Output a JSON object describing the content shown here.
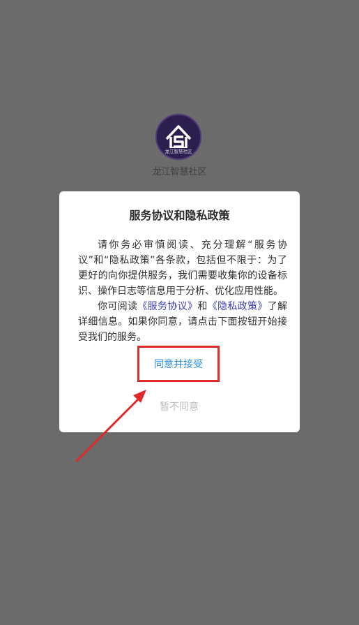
{
  "app": {
    "name": "龙江智慧社区",
    "logo_text": "龙江智慧社区"
  },
  "dialog": {
    "title": "服务协议和隐私政策",
    "paragraph1": "请你务必审慎阅读、充分理解“服务协议”和“隐私政策”各条款，包括但不限于：为了更好的向你提供服务，我们需要收集你的设备标识、操作日志等信息用于分析、优化应用性能。",
    "p2_prefix": "你可阅读",
    "service_link": "《服务协议》",
    "p2_and": "和",
    "privacy_link": "《隐私政策》",
    "p2_suffix": "了解详细信息。如果你同意，请点击下面按钮开始接受我们的服务。",
    "accept_label": "同意并接受",
    "decline_label": "暂不同意"
  },
  "colors": {
    "overlay": "#6b6b6b",
    "link": "#3d3db5",
    "accept": "#2b8fd6",
    "decline": "#bdbdbd",
    "highlight": "#e02a2a"
  }
}
